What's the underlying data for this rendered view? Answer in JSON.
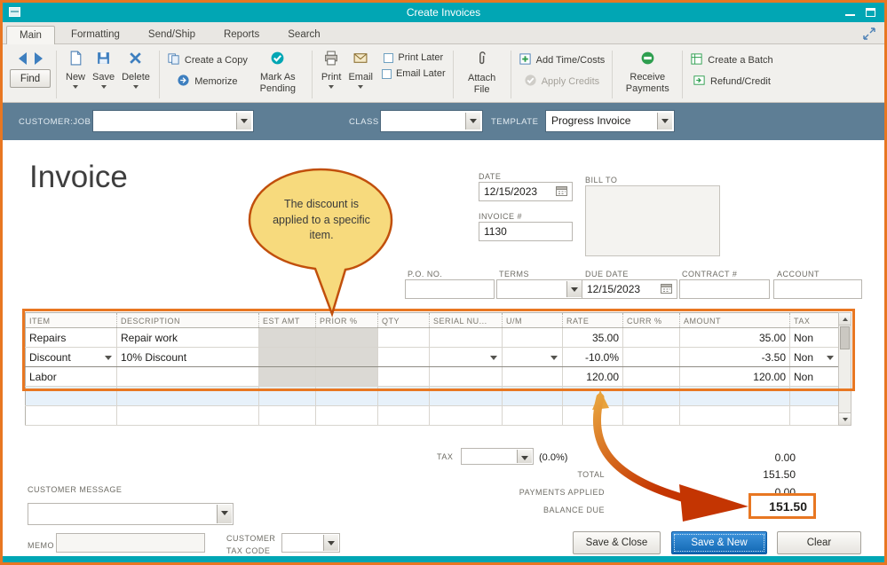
{
  "window": {
    "title": "Create Invoices"
  },
  "tabs": [
    "Main",
    "Formatting",
    "Send/Ship",
    "Reports",
    "Search"
  ],
  "toolbar": {
    "find": "Find",
    "new": "New",
    "save": "Save",
    "delete": "Delete",
    "create_a_copy": "Create a Copy",
    "memorize": "Memorize",
    "mark_as_pending": "Mark As Pending",
    "print": "Print",
    "email": "Email",
    "print_later": "Print Later",
    "email_later": "Email Later",
    "attach_file": "Attach File",
    "add_time_costs": "Add Time/Costs",
    "apply_credits": "Apply Credits",
    "receive_payments": "Receive Payments",
    "create_a_batch": "Create a Batch",
    "refund_credit": "Refund/Credit"
  },
  "form_bar": {
    "customer_job": "CUSTOMER:JOB",
    "customer_job_value": "",
    "class": "CLASS",
    "class_value": "",
    "template": "TEMPLATE",
    "template_value": "Progress Invoice"
  },
  "invoice": {
    "title": "Invoice",
    "date_label": "DATE",
    "date": "12/15/2023",
    "number_label": "INVOICE #",
    "number": "1130",
    "bill_to_label": "BILL TO",
    "po_label": "P.O. NO.",
    "po_value": "",
    "terms_label": "TERMS",
    "terms_value": "",
    "due_date_label": "DUE DATE",
    "due_date": "12/15/2023",
    "contract_label": "CONTRACT #",
    "contract_value": "",
    "account_label": "ACCOUNT",
    "account_value": ""
  },
  "callout": {
    "text": "The discount is applied to a specific item."
  },
  "table": {
    "columns": [
      "ITEM",
      "DESCRIPTION",
      "EST AMT",
      "PRIOR %",
      "QTY",
      "SERIAL NU...",
      "U/M",
      "RATE",
      "CURR %",
      "AMOUNT",
      "TAX"
    ],
    "rows": [
      {
        "item": "Repairs",
        "description": "Repair work",
        "est_amt": "",
        "prior_pct": "",
        "qty": "",
        "serial": "",
        "um": "",
        "rate": "35.00",
        "curr_pct": "",
        "amount": "35.00",
        "tax": "Non"
      },
      {
        "item": "Discount",
        "description": "10% Discount",
        "est_amt": "",
        "prior_pct": "",
        "qty": "",
        "serial": "",
        "um": "",
        "rate": "-10.0%",
        "curr_pct": "",
        "amount": "-3.50",
        "tax": "Non"
      },
      {
        "item": "Labor",
        "description": "",
        "est_amt": "",
        "prior_pct": "",
        "qty": "",
        "serial": "",
        "um": "",
        "rate": "120.00",
        "curr_pct": "",
        "amount": "120.00",
        "tax": "Non"
      }
    ]
  },
  "totals": {
    "tax_label": "TAX",
    "tax_value": "",
    "tax_rate": "(0.0%)",
    "tax_amount": "0.00",
    "total_label": "TOTAL",
    "total_amount": "151.50",
    "payments_label": "PAYMENTS APPLIED",
    "payments_amount": "0.00",
    "balance_label": "BALANCE DUE",
    "balance_amount": "151.50"
  },
  "footer": {
    "customer_message_label": "CUSTOMER MESSAGE",
    "customer_message_value": "",
    "memo_label": "MEMO",
    "memo_value": "",
    "customer_tax_code_label": "CUSTOMER TAX CODE",
    "customer_tax_code_value": "",
    "save_close": "Save & Close",
    "save_new": "Save & New",
    "clear": "Clear"
  },
  "icons": {
    "back": "triangle-left",
    "forward": "triangle-right",
    "new": "page",
    "save": "floppy-disk",
    "delete": "x-mark",
    "create_a_copy": "two-pages",
    "memorize": "arrow-circle",
    "mark_as_pending": "check-circle",
    "print": "printer",
    "email": "envelope",
    "attach_file": "paperclip",
    "add_time_costs": "plus-square",
    "apply_credits": "gray-circle",
    "receive_payments": "green-coin",
    "create_a_batch": "spreadsheet",
    "refund_credit": "return-arrow",
    "calendar": "calendar-grid",
    "dropdown": "triangle-down",
    "scroll_up": "triangle-up",
    "scroll_down": "triangle-down"
  },
  "colors": {
    "titlebar_teal": "#01A6B4",
    "highlight_orange": "#E87722",
    "primary_button_blue": "#1268B3",
    "form_bar_blue": "#5E7E95",
    "callout_yellow": "#F7DA7D",
    "arrow_red": "#C43502"
  }
}
